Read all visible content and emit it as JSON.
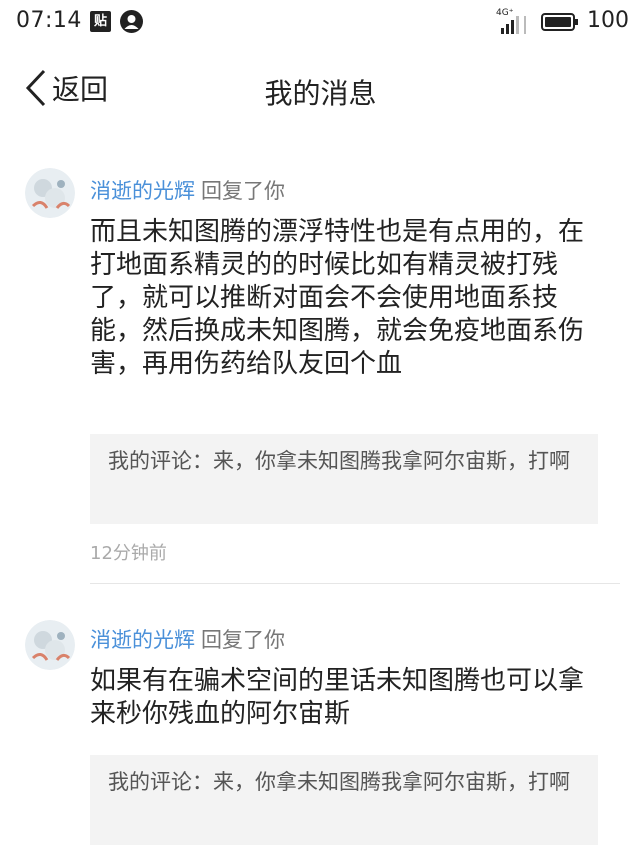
{
  "status_bar": {
    "time": "07:14",
    "app_icon_text": "贴",
    "network": "4G⁺",
    "battery": "100"
  },
  "nav": {
    "back_label": "返回",
    "title": "我的消息"
  },
  "messages": [
    {
      "user": "消逝的光辉",
      "action": "回复了你",
      "body": "而且未知图腾的漂浮特性也是有点用的，在打地面系精灵的的时候比如有精灵被打残了，就可以推断对面会不会使用地面系技能，然后换成未知图腾，就会免疫地面系伤害，再用伤药给队友回个血",
      "comment": "我的评论：来，你拿未知图腾我拿阿尔宙斯，打啊",
      "time": "12分钟前"
    },
    {
      "user": "消逝的光辉",
      "action": "回复了你",
      "body": "如果有在骗术空间的里话未知图腾也可以拿来秒你残血的阿尔宙斯",
      "comment": "我的评论：来，你拿未知图腾我拿阿尔宙斯，打啊"
    }
  ],
  "colors": {
    "username": "#4a90d9",
    "comment_bg": "#f3f3f3"
  }
}
